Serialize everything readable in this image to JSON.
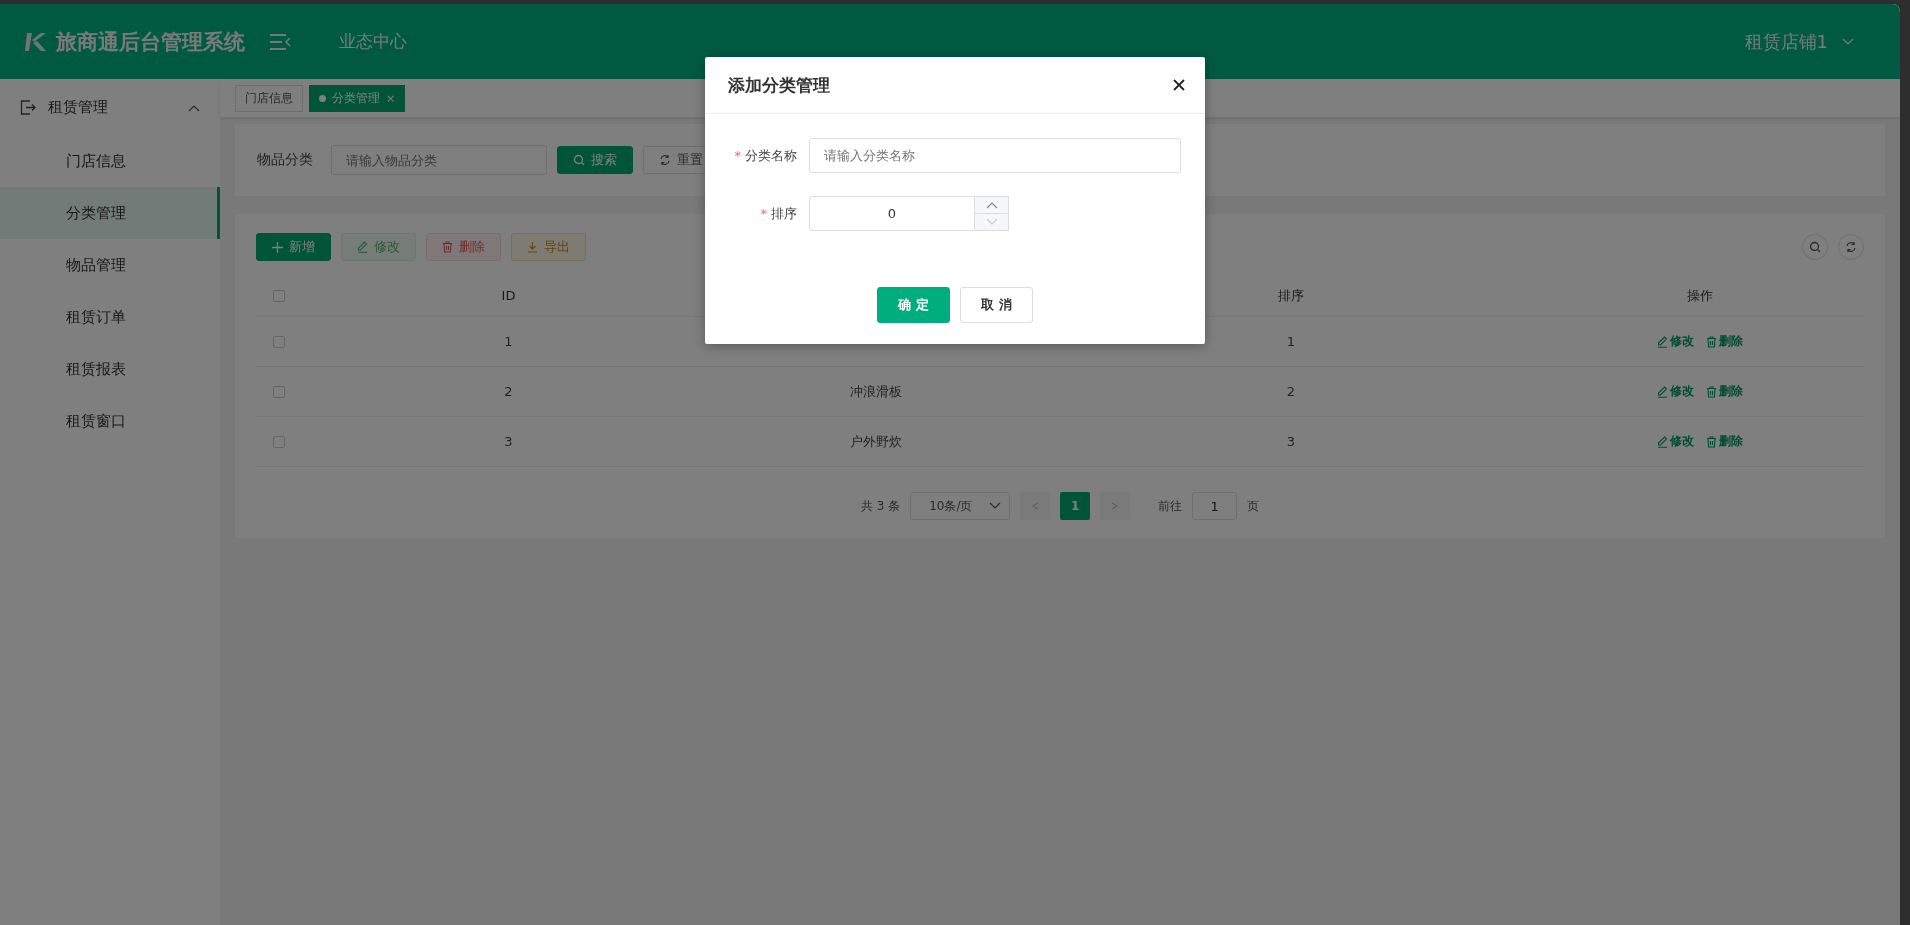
{
  "header": {
    "title": "旅商通后台管理系统",
    "nav": "业态中心",
    "user": "租赁店铺1"
  },
  "sidebar": {
    "group": {
      "label": "租赁管理",
      "expanded": true
    },
    "items": [
      {
        "label": "门店信息",
        "selected": false
      },
      {
        "label": "分类管理",
        "selected": true
      },
      {
        "label": "物品管理",
        "selected": false
      },
      {
        "label": "租赁订单",
        "selected": false
      },
      {
        "label": "租赁报表",
        "selected": false
      },
      {
        "label": "租赁窗口",
        "selected": false
      }
    ]
  },
  "tabs": [
    {
      "label": "门店信息",
      "selected": false
    },
    {
      "label": "分类管理",
      "selected": true,
      "close": "×"
    }
  ],
  "search": {
    "label": "物品分类",
    "placeholder": "请输入物品分类",
    "buttons": [
      {
        "label": "搜索",
        "kind": "primary"
      },
      {
        "label": "重置",
        "kind": "plain"
      }
    ]
  },
  "toolbar": [
    {
      "label": "新增",
      "kind": "add",
      "disabled": false
    },
    {
      "label": "修改",
      "kind": "edit",
      "disabled": true
    },
    {
      "label": "删除",
      "kind": "delete",
      "disabled": true
    },
    {
      "label": "导出",
      "kind": "export",
      "disabled": false
    }
  ],
  "table": {
    "all_checked": false,
    "columns": [
      "ID",
      null,
      "排序",
      "操作"
    ],
    "rows": [
      {
        "checked": false,
        "cells": [
          "1",
          null,
          "1"
        ],
        "actions": [
          "修改",
          "删除"
        ]
      },
      {
        "checked": false,
        "cells": [
          "2",
          "冲浪滑板",
          "2"
        ],
        "actions": [
          "修改",
          "删除"
        ]
      },
      {
        "checked": false,
        "cells": [
          "3",
          "户外野炊",
          "3"
        ],
        "actions": [
          "修改",
          "删除"
        ]
      }
    ]
  },
  "pagination": {
    "total": "共 3 条",
    "page_size": "10条/页",
    "pages": [
      {
        "label": "1",
        "selected": true
      }
    ],
    "goto_label": "前往",
    "goto_value": "1",
    "goto_suffix": "页"
  },
  "dialog": {
    "title": "添加分类管理",
    "required_mark": "*",
    "fields": [
      {
        "kind": "text",
        "label": "分类名称",
        "required": true,
        "placeholder": "请输入分类名称"
      },
      {
        "kind": "number",
        "label": "排序",
        "required": true,
        "value": "0"
      }
    ],
    "buttons": [
      {
        "label": "确 定",
        "kind": "primary"
      },
      {
        "label": "取 消",
        "kind": "plain"
      }
    ]
  }
}
